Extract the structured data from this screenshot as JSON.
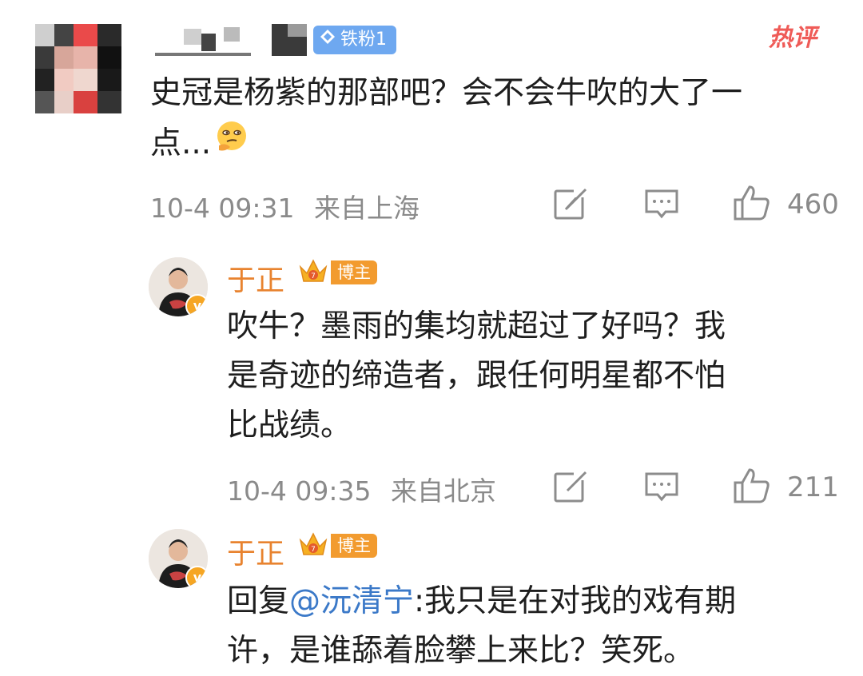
{
  "top_comment": {
    "badge": "铁粉1",
    "hot_tag": "热评",
    "text_line1": "史冠是杨紫的那部吧？会不会牛吹的大了一",
    "text_line2": "点...",
    "emoji": "thinking-face-icon",
    "timestamp": "10-4 09:31",
    "location": "来自上海",
    "likes": "460"
  },
  "replies": [
    {
      "name": "于正",
      "badge": "博主",
      "text_lines": [
        "吹牛？墨雨的集均就超过了好吗？我",
        "是奇迹的缔造者，跟任何明星都不怕",
        "比战绩。"
      ],
      "timestamp": "10-4 09:35",
      "location": "来自北京",
      "likes": "211"
    },
    {
      "name": "于正",
      "badge": "博主",
      "reply_prefix": "回复",
      "mention": "@沅清宁",
      "text_after_mention": ":我只是在对我的戏有期",
      "text_line2": "许，是谁舔着脸攀上来比？笑死。"
    }
  ],
  "colors": {
    "name_orange": "#e8832f",
    "mention_blue": "#3b79c8",
    "meta_gray": "#8a8a8a",
    "hot_red": "#ef5b57",
    "fan_badge_blue": "#6ea8f0"
  }
}
